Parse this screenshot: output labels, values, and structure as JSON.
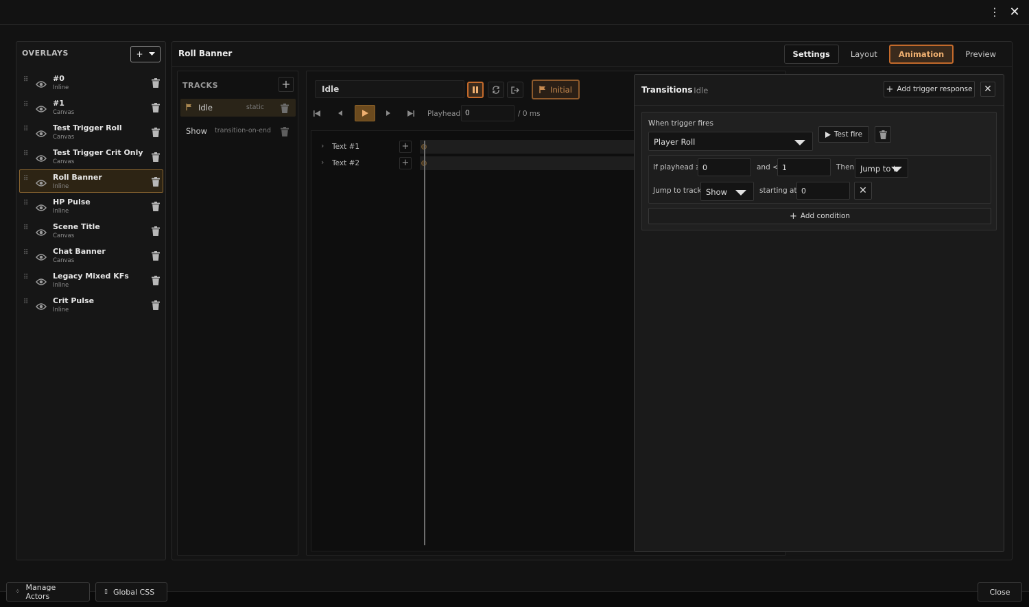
{
  "window": {
    "menu_icon": "kebab-icon",
    "close_icon": "close-icon"
  },
  "overlays": {
    "heading": "OVERLAYS",
    "add_label": "+",
    "items": [
      {
        "name": "#0",
        "type": "Inline",
        "selected": false
      },
      {
        "name": "#1",
        "type": "Canvas",
        "selected": false
      },
      {
        "name": "Test Trigger Roll",
        "type": "Canvas",
        "selected": false
      },
      {
        "name": "Test Trigger Crit Only",
        "type": "Canvas",
        "selected": false
      },
      {
        "name": "Roll Banner",
        "type": "Inline",
        "selected": true
      },
      {
        "name": "HP Pulse",
        "type": "Inline",
        "selected": false
      },
      {
        "name": "Scene Title",
        "type": "Canvas",
        "selected": false
      },
      {
        "name": "Chat Banner",
        "type": "Canvas",
        "selected": false
      },
      {
        "name": "Legacy Mixed KFs",
        "type": "Inline",
        "selected": false
      },
      {
        "name": "Crit Pulse",
        "type": "Inline",
        "selected": false
      }
    ]
  },
  "editor": {
    "title": "Roll Banner",
    "tabs": [
      {
        "label": "Settings",
        "state": "boxed"
      },
      {
        "label": "Layout",
        "state": "plain"
      },
      {
        "label": "Animation",
        "state": "active"
      },
      {
        "label": "Preview",
        "state": "plain"
      }
    ]
  },
  "tracks": {
    "heading": "TRACKS",
    "add_label": "+",
    "items": [
      {
        "name": "Idle",
        "mode": "static",
        "selected": true,
        "initial": true
      },
      {
        "name": "Show",
        "mode": "transition-on-end",
        "selected": false,
        "initial": false
      }
    ]
  },
  "timeline": {
    "track_name": "Idle",
    "initial_label": "Initial",
    "playhead_label": "Playhead",
    "playhead_value": "0",
    "duration_label": "/ 0 ms",
    "lanes": [
      {
        "label": "Text #1"
      },
      {
        "label": "Text #2"
      }
    ]
  },
  "transitions": {
    "title": "Transitions",
    "subtitle": "· Idle",
    "add_label": "Add trigger response",
    "when_label": "When trigger fires",
    "trigger": "Player Roll",
    "test_fire_label": "Test fire",
    "if_label": "If playhead ≥",
    "from_value": "0",
    "and_label": "and <",
    "to_value": "1",
    "then_label": "Then",
    "action": "Jump to track",
    "jump_label": "Jump to track",
    "target_track": "Show",
    "starting_label": "starting at",
    "start_value": "0",
    "add_condition_label": "Add condition"
  },
  "footer": {
    "manage_actors": "Manage Actors",
    "global_css": "Global CSS",
    "close": "Close"
  },
  "colors": {
    "accent": "#c46a2b",
    "accent_text": "#f0b070",
    "bg": "#121212"
  }
}
